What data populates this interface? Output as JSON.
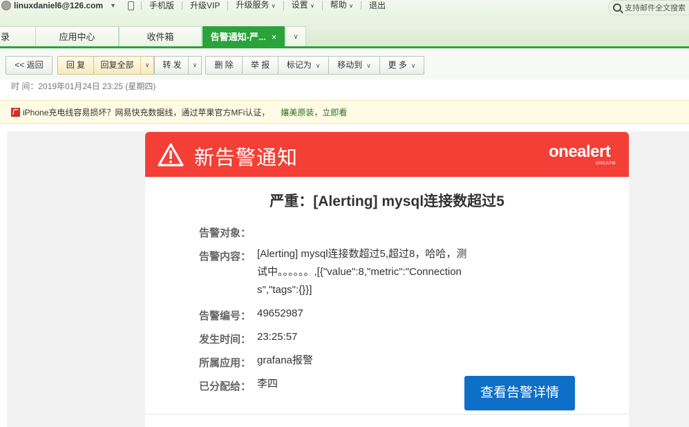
{
  "topbar": {
    "user_email": "linuxdaniel6@126.com",
    "nav": [
      "手机版",
      "升级VIP",
      "升级服务",
      "设置",
      "帮助",
      "退出"
    ],
    "search_placeholder": "支持邮件全文搜索"
  },
  "tabs": [
    {
      "label": "录"
    },
    {
      "label": "应用中心"
    },
    {
      "label": "收件箱"
    },
    {
      "label": "告警通知-严..."
    }
  ],
  "toolbar": {
    "back": "<< 返回",
    "reply": "回 复",
    "reply_all": "回复全部",
    "forward": "转 发",
    "delete": "删 除",
    "report": "举 报",
    "mark_as": "标记为",
    "move_to": "移动到",
    "more": "更 多"
  },
  "mail_meta": {
    "time_label": "时  间：",
    "time_value": "2019年01月24日 23:25 (星期四)"
  },
  "ad": {
    "icon_text": "广",
    "text": "iPhone充电线容易损坏？网易快充数据线，通过苹果官方MFi认证，",
    "link": "孃美原装，立即看"
  },
  "alert": {
    "header_title": "新告警通知",
    "brand": "onealert",
    "brand_sub": "ONEAPM",
    "heading": "严重：[Alerting] mysql连接数超过5",
    "fields": [
      {
        "label": "告警对象：",
        "value": ""
      },
      {
        "label": "告警内容：",
        "value": "[Alerting] mysql连接数超过5,超过8，哈哈，测试中。。。。。。,[{\"value\":8,\"metric\":\"Connections\",\"tags\":{}}]"
      },
      {
        "label": "告警编号：",
        "value": "49652987"
      },
      {
        "label": "发生时间：",
        "value": "23:25:57"
      },
      {
        "label": "所属应用：",
        "value": "grafana报警"
      },
      {
        "label": "已分配给：",
        "value": "李四"
      }
    ],
    "cta": "查看告警详情"
  },
  "colors": {
    "header_red": "#f33f36",
    "tab_green": "#2aa33a",
    "cta_blue": "#0e6fc7"
  }
}
